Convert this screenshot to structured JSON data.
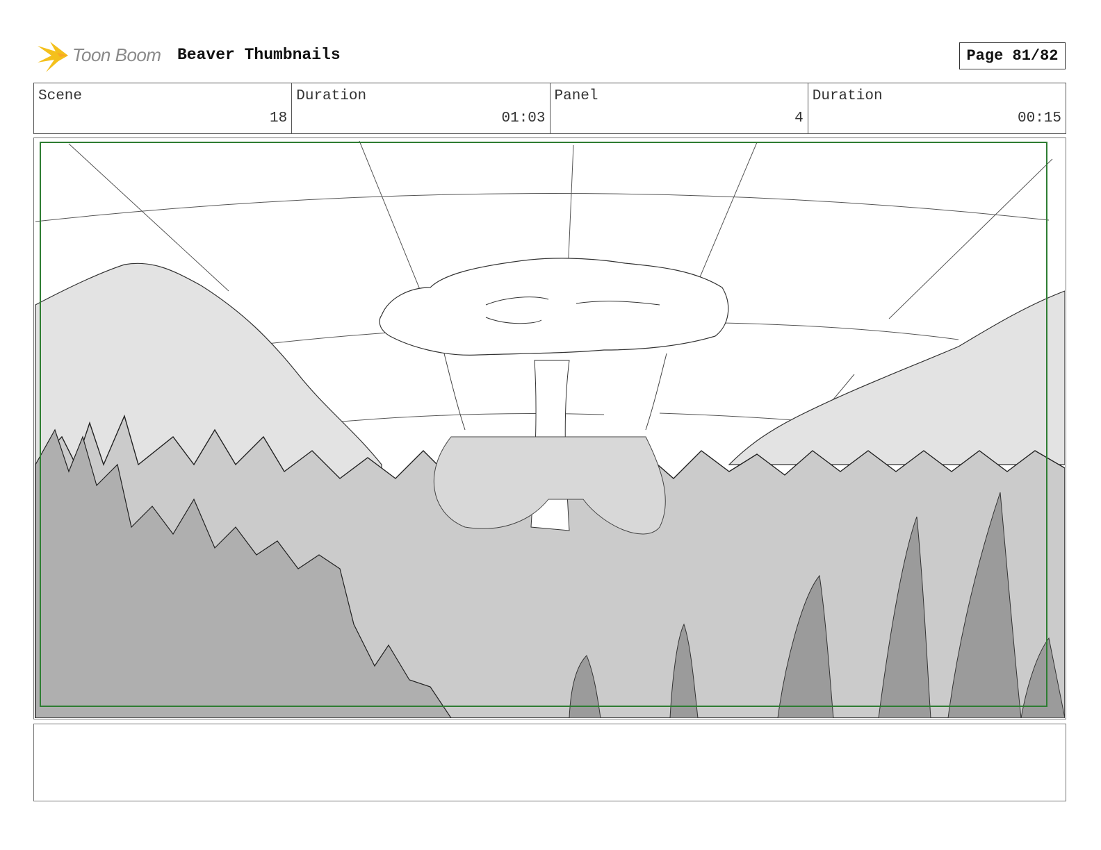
{
  "header": {
    "logo_text": "Toon Boom",
    "project_title": "Beaver Thumbnails",
    "page_label": "Page 81/82"
  },
  "info": {
    "scene_label": "Scene",
    "scene_value": "18",
    "scene_duration_label": "Duration",
    "scene_duration_value": "01:03",
    "panel_label": "Panel",
    "panel_value": "4",
    "panel_duration_label": "Duration",
    "panel_duration_value": "00:15"
  },
  "notes": {
    "text": ""
  },
  "colors": {
    "logo_accent": "#f4c01c",
    "safe_frame": "#2e7d32"
  },
  "icons": {
    "logo": "toon-boom-star-icon"
  }
}
